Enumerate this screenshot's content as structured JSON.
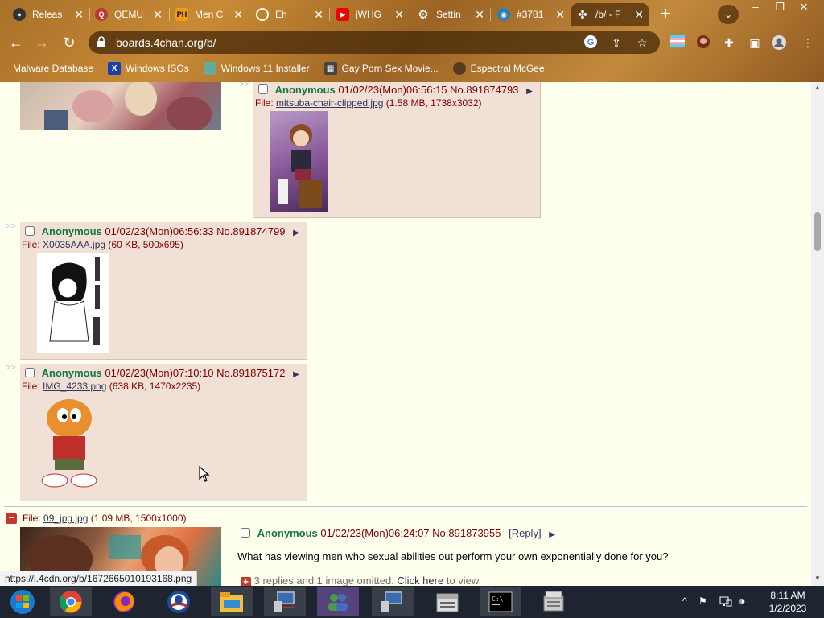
{
  "tabs": [
    {
      "title": "Releas",
      "icon": "github-icon"
    },
    {
      "title": "QEMU",
      "icon": "qemu-icon"
    },
    {
      "title": "Men C",
      "icon": "ph-icon",
      "badge": "PH"
    },
    {
      "title": "Eh",
      "icon": "globe-icon"
    },
    {
      "title": "jWHG",
      "icon": "youtube-icon"
    },
    {
      "title": "Settin",
      "icon": "settings-icon"
    },
    {
      "title": "#3781",
      "icon": "issue-icon"
    },
    {
      "title": "/b/ - F",
      "icon": "clover-icon",
      "active": true
    }
  ],
  "url": "boards.4chan.org/b/",
  "bookmarks": [
    {
      "label": "Malware Database",
      "icon": "malware-icon"
    },
    {
      "label": "Windows ISOs",
      "icon": "x-icon",
      "badge": "X"
    },
    {
      "label": "Windows 11 Installer",
      "icon": "installer-icon"
    },
    {
      "label": "Gay Porn Sex Movie...",
      "icon": "clapper-icon"
    },
    {
      "label": "Espectral McGee",
      "icon": "avatar-icon"
    }
  ],
  "posts": [
    {
      "name": "Anonymous",
      "datetime": "01/02/23(Mon)06:56:15",
      "no": "No.891874793",
      "file_prefix": "File: ",
      "file_name": "mitsuba-chair-clipped.jpg",
      "file_meta": "(1.58 MB, 1738x3032)"
    },
    {
      "name": "Anonymous",
      "datetime": "01/02/23(Mon)06:56:33",
      "no": "No.891874799",
      "file_prefix": "File: ",
      "file_name": "X0035AAA.jpg",
      "file_meta": "(60 KB, 500x695)"
    },
    {
      "name": "Anonymous",
      "datetime": "01/02/23(Mon)07:10:10",
      "no": "No.891875172",
      "file_prefix": "File: ",
      "file_name": "IMG_4233.png",
      "file_meta": "(638 KB, 1470x2235)"
    }
  ],
  "reply_arrows": ">>",
  "thread": {
    "file_prefix": "File: ",
    "file_name": "09_jpg.jpg",
    "file_meta": "(1.09 MB, 1500x1000)",
    "name": "Anonymous",
    "datetime": "01/02/23(Mon)06:24:07",
    "no": "No.891873955",
    "reply_link": "[Reply]",
    "subject_text": "What has viewing men who sexual abilities out perform your own exponentially done for you?",
    "omitted_text": "3 replies and 1 image omitted.",
    "click_here": "Click here",
    "to_view": "to view."
  },
  "status_url": "https://i.4cdn.org/b/1672665010193168.png",
  "clock": {
    "time": "8:11 AM",
    "date": "1/2/2023"
  },
  "colors": {
    "name": "#117743",
    "post_bg": "#f0e0d6",
    "page_bg": "#ffffee",
    "link": "#34345c"
  }
}
